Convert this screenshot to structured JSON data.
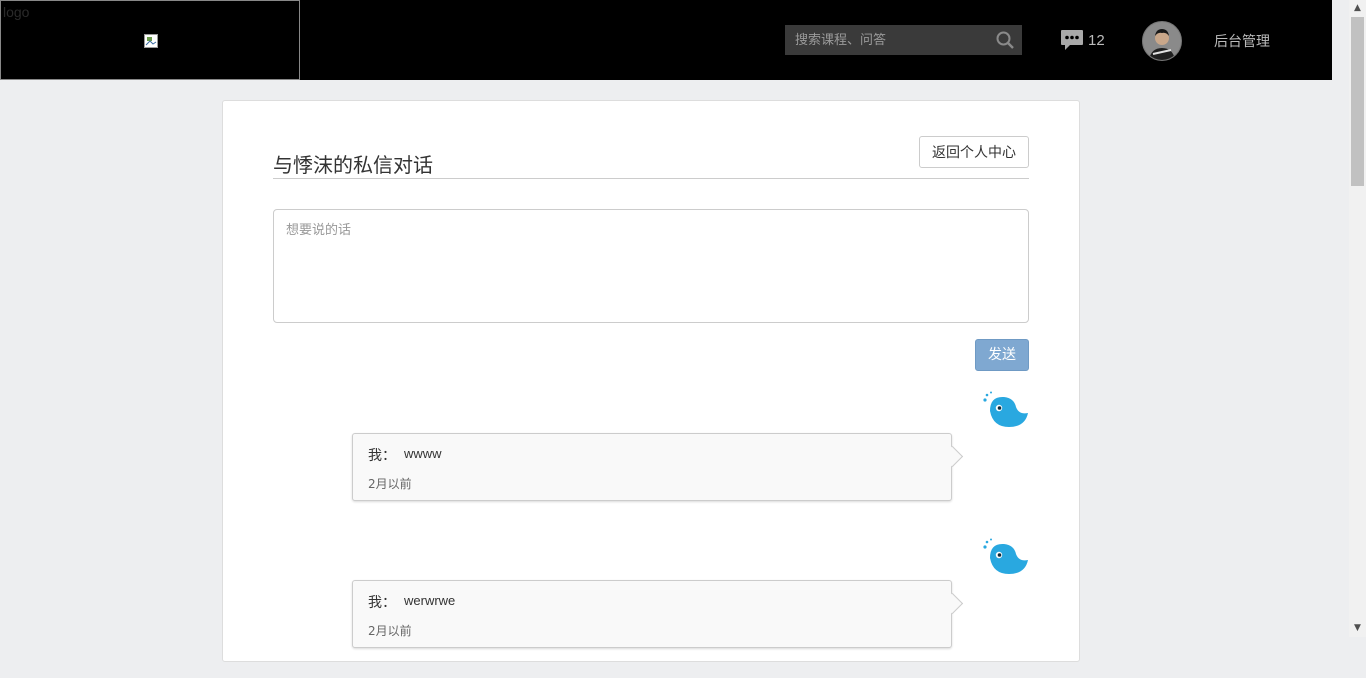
{
  "header": {
    "logo_alt": "logo",
    "search_placeholder": "搜索课程、问答",
    "message_count": "12",
    "admin_label": "后台管理"
  },
  "page": {
    "title": "与悸沫的私信对话",
    "back_button": "返回个人中心",
    "textarea_placeholder": "想要说的话",
    "send_button": "发送"
  },
  "messages": [
    {
      "author": "我：",
      "text": "wwww",
      "time": "2月以前"
    },
    {
      "author": "我：",
      "text": "werwrwe",
      "time": "2月以前"
    }
  ],
  "colors": {
    "header_bg": "#000000",
    "page_bg": "#edeef0",
    "send_button_bg": "#7fa8d1",
    "bird_blue": "#29a8e0"
  }
}
